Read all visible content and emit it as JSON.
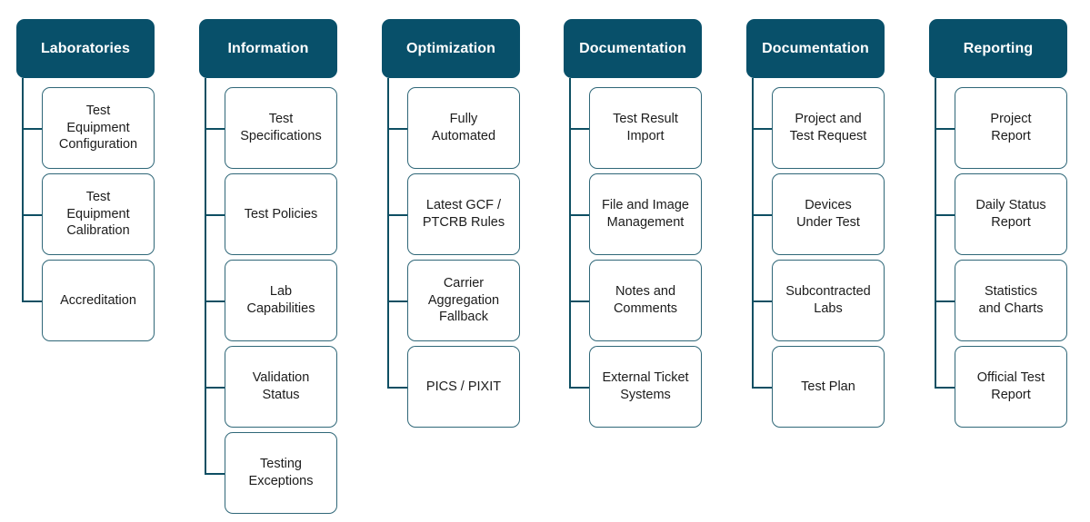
{
  "diagram": {
    "type": "feature-tree",
    "background_color": "#ffffff",
    "header_color": "#08506a",
    "header_text_color": "#ffffff",
    "box_border_color": "#2f6778",
    "box_text_color": "#1c1c1c",
    "connector_color": "#0e4f63",
    "columns": [
      {
        "header": "Laboratories",
        "items": [
          "Test\nEquipment\nConfiguration",
          "Test\nEquipment\nCalibration",
          "Accreditation"
        ]
      },
      {
        "header": "Information",
        "items": [
          "Test\nSpecifications",
          "Test Policies",
          "Lab\nCapabilities",
          "Validation\nStatus",
          "Testing\nExceptions"
        ]
      },
      {
        "header": "Optimization",
        "items": [
          "Fully\nAutomated",
          "Latest GCF /\nPTCRB Rules",
          "Carrier\nAggregation\nFallback",
          "PICS / PIXIT"
        ]
      },
      {
        "header": "Documentation",
        "items": [
          "Test Result\nImport",
          "File and Image\nManagement",
          "Notes and\nComments",
          "External Ticket\nSystems"
        ]
      },
      {
        "header": "Documentation",
        "items": [
          "Project and\nTest Request",
          "Devices\nUnder Test",
          "Subcontracted\nLabs",
          "Test Plan"
        ]
      },
      {
        "header": "Reporting",
        "items": [
          "Project\nReport",
          "Daily Status\nReport",
          "Statistics\nand Charts",
          "Official Test\nReport"
        ]
      }
    ]
  }
}
